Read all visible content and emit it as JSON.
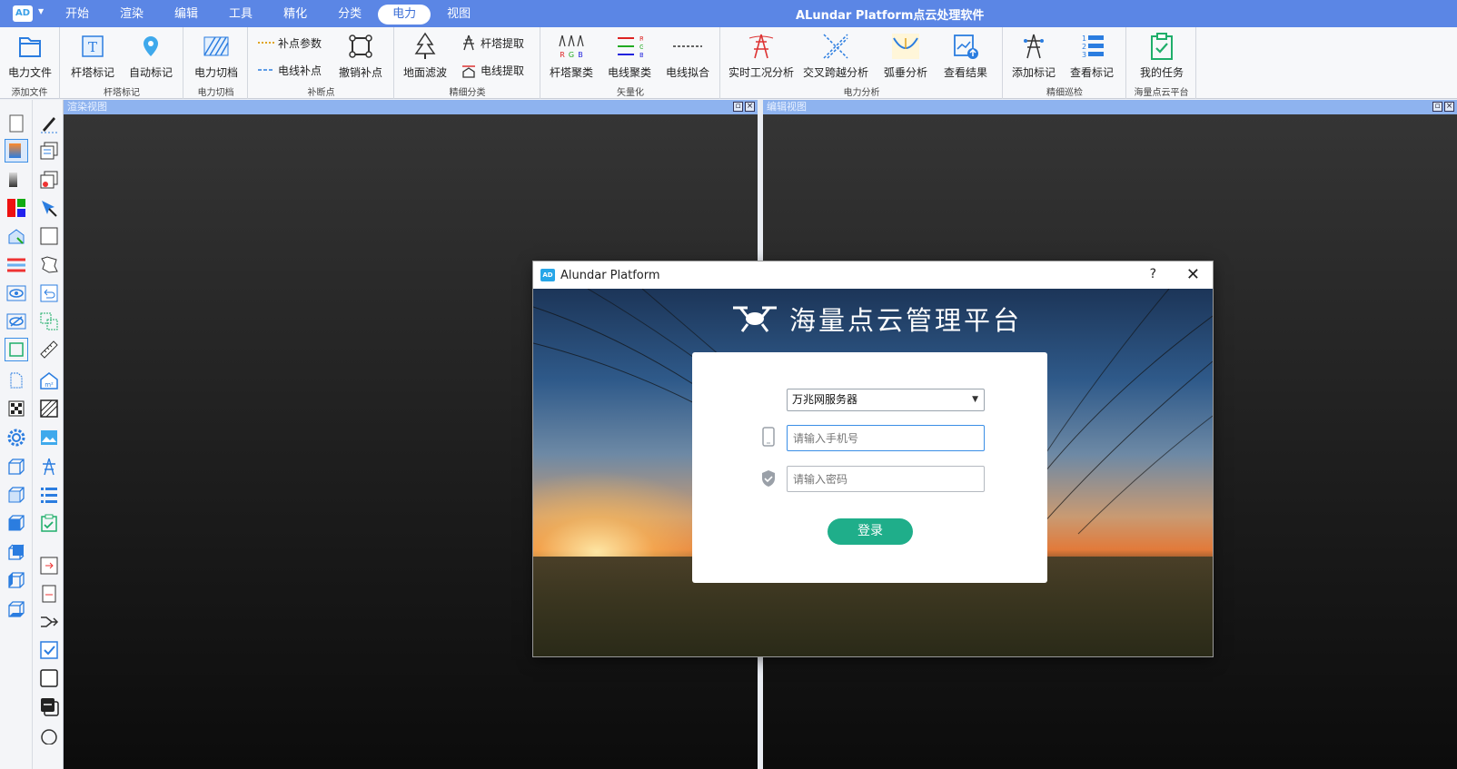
{
  "app": {
    "logo_text": "AD",
    "title": "ALundar Platform点云处理软件"
  },
  "menu": [
    {
      "label": "开始"
    },
    {
      "label": "渲染"
    },
    {
      "label": "编辑"
    },
    {
      "label": "工具"
    },
    {
      "label": "精化"
    },
    {
      "label": "分类"
    },
    {
      "label": "电力",
      "active": true
    },
    {
      "label": "视图"
    }
  ],
  "ribbon": {
    "groups": {
      "add_file": "添加文件",
      "tower_mark": "杆塔标记",
      "power_cut": "电力切档",
      "fill_point": "补断点",
      "fine_class": "精细分类",
      "vectorize": "矢量化",
      "power_analysis": "电力分析",
      "fine_patrol": "精细巡检",
      "cloud_platform": "海量点云平台"
    },
    "buttons": {
      "power_file": "电力文件",
      "tower_mark": "杆塔标记",
      "auto_mark": "自动标记",
      "power_cut": "电力切档",
      "fill_params": "补点参数",
      "line_fill": "电线补点",
      "undo_fill": "撤销补点",
      "ground_filter": "地面滤波",
      "tower_extract": "杆塔提取",
      "line_extract": "电线提取",
      "tower_cluster": "杆塔聚类",
      "line_cluster": "电线聚类",
      "line_fit": "电线拟合",
      "realtime_analysis": "实时工况分析",
      "cross_analysis": "交叉跨越分析",
      "sag_analysis": "弧垂分析",
      "view_results": "查看结果",
      "add_mark": "添加标记",
      "view_mark": "查看标记",
      "my_tasks": "我的任务"
    }
  },
  "views": {
    "render_title": "渲染视图",
    "edit_title": "编辑视图"
  },
  "dialog": {
    "title": "Alundar Platform",
    "help": "?",
    "brand": "海量点云管理平台",
    "server": "万兆网服务器",
    "phone_placeholder": "请输入手机号",
    "password_placeholder": "请输入密码",
    "login_label": "登录"
  },
  "colors": {
    "titlebar": "#5b86e5",
    "view_header": "#8eb3ef",
    "login_button": "#1fae8a",
    "focus_border": "#3a8ee6"
  }
}
